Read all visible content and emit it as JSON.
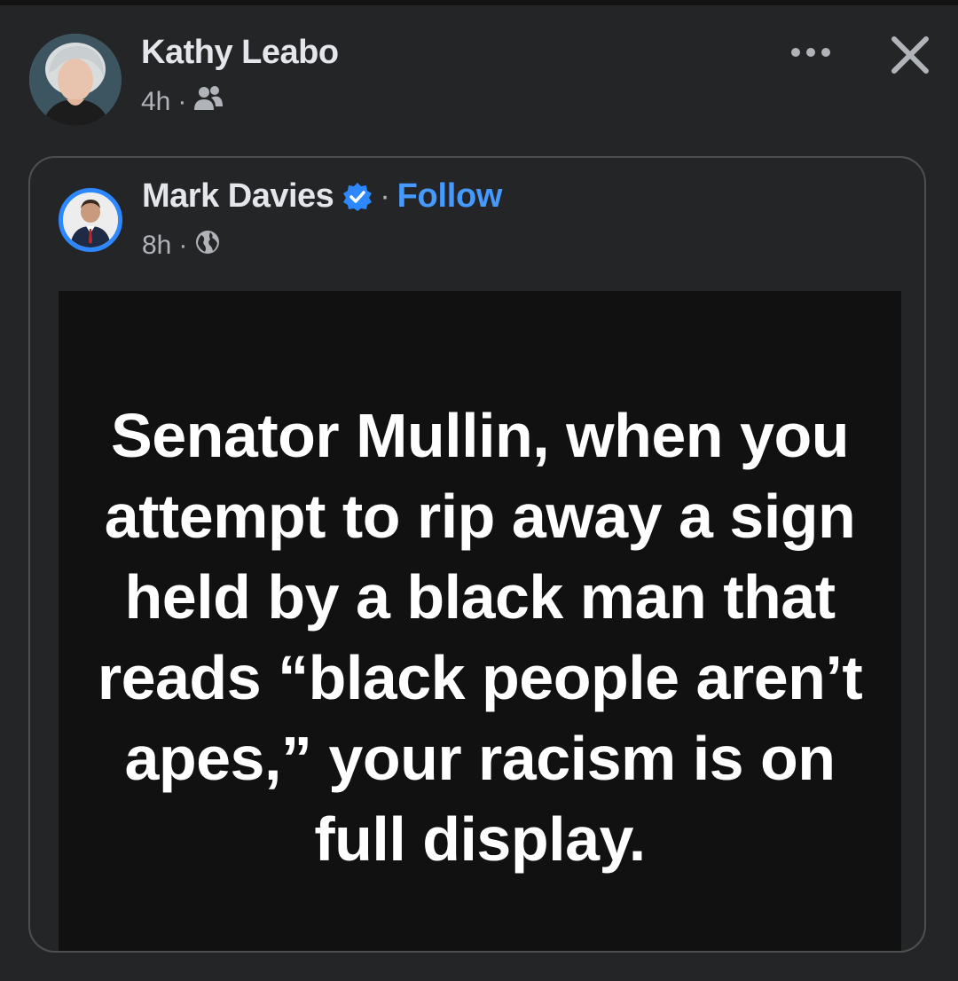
{
  "sharer": {
    "name": "Kathy Leabo",
    "time": "4h",
    "separator": "·",
    "audience_icon": "friends-icon"
  },
  "header_actions": {
    "more_icon": "more-options-icon",
    "close_icon": "close-icon"
  },
  "shared_post": {
    "author_name": "Mark Davies",
    "verified_icon": "verified-badge-icon",
    "separator": "·",
    "follow_label": "Follow",
    "time": "8h",
    "audience_icon": "globe-icon",
    "image_text": "Senator Mullin, when you attempt to rip away a sign held by a black man that reads “black people aren’t apes,” your racism is on full display."
  },
  "colors": {
    "background": "#242526",
    "card_border": "#4e4f50",
    "link_blue": "#4599ff",
    "image_background": "#111111"
  }
}
